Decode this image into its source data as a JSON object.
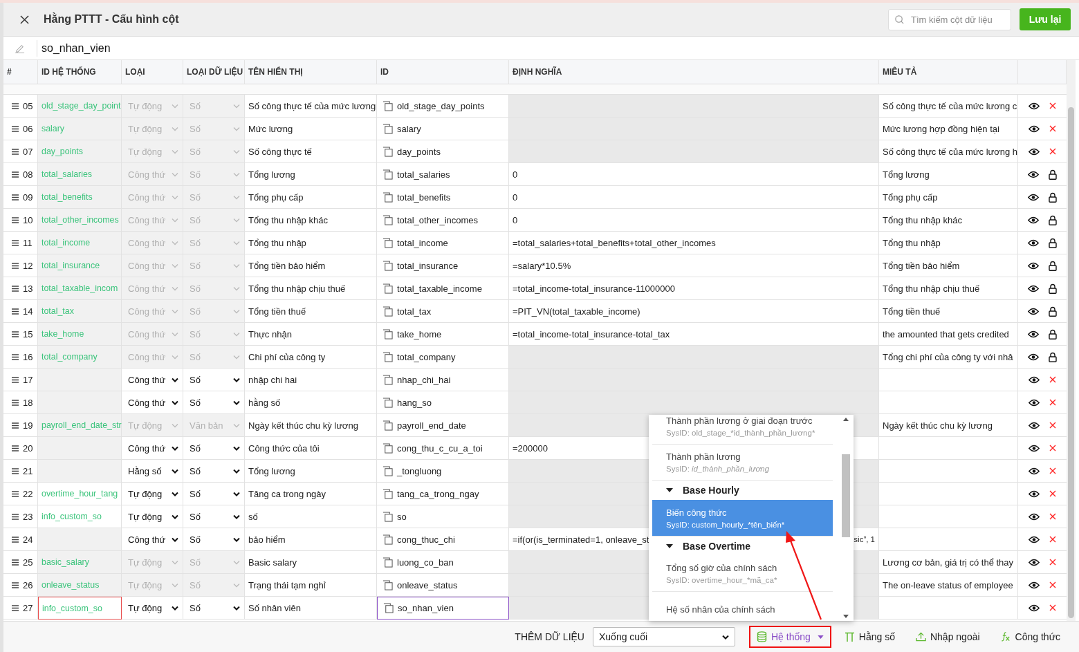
{
  "header": {
    "title": "Hằng PTTT - Cấu hình cột",
    "search": {
      "placeholder": "Tìm kiếm cột dữ liệu"
    },
    "save_button": "Lưu lại"
  },
  "name_field": {
    "value": "so_nhan_vien"
  },
  "table": {
    "columns": [
      "#",
      "ID HỆ THỐNG",
      "LOẠI",
      "LOẠI DỮ LIỆU",
      "TÊN HIỂN THỊ",
      "ID",
      "ĐỊNH NGHĨA",
      "MIÊU TẢ"
    ],
    "rows": [
      {
        "n": "05",
        "sys_id": "old_stage_day_point",
        "sys_id_disabled": true,
        "invalid": false,
        "type": "Tự động",
        "data_type": "Số",
        "locked": true,
        "display": "Số công thực tế của mức lương",
        "id": "old_stage_day_points",
        "focused": false,
        "definition": "",
        "definition_disabled": true,
        "description": "Số công thực tế của mức lương c",
        "protected": false
      },
      {
        "n": "06",
        "sys_id": "salary",
        "sys_id_disabled": true,
        "invalid": false,
        "type": "Tự động",
        "data_type": "Số",
        "locked": true,
        "display": "Mức lương",
        "id": "salary",
        "focused": false,
        "definition": "",
        "definition_disabled": true,
        "description": "Mức lương hợp đồng hiện tại",
        "protected": false
      },
      {
        "n": "07",
        "sys_id": "day_points",
        "sys_id_disabled": true,
        "invalid": false,
        "type": "Tự động",
        "data_type": "Số",
        "locked": true,
        "display": "Số công thực tế",
        "id": "day_points",
        "focused": false,
        "definition": "",
        "definition_disabled": true,
        "description": "Số công thực tế của mức lương h",
        "protected": false
      },
      {
        "n": "08",
        "sys_id": "total_salaries",
        "sys_id_disabled": true,
        "invalid": false,
        "type": "Công thứ",
        "data_type": "Số",
        "locked": true,
        "display": "Tổng lương",
        "id": "total_salaries",
        "focused": false,
        "definition": "0",
        "definition_disabled": false,
        "description": "Tổng lương",
        "protected": true
      },
      {
        "n": "09",
        "sys_id": "total_benefits",
        "sys_id_disabled": true,
        "invalid": false,
        "type": "Công thứ",
        "data_type": "Số",
        "locked": true,
        "display": "Tổng phụ cấp",
        "id": "total_benefits",
        "focused": false,
        "definition": "0",
        "definition_disabled": false,
        "description": "Tổng phụ cấp",
        "protected": true
      },
      {
        "n": "10",
        "sys_id": "total_other_incomes",
        "sys_id_disabled": true,
        "invalid": false,
        "type": "Công thứ",
        "data_type": "Số",
        "locked": true,
        "display": "Tổng thu nhập khác",
        "id": "total_other_incomes",
        "focused": false,
        "definition": "0",
        "definition_disabled": false,
        "description": "Tổng thu nhập khác",
        "protected": true
      },
      {
        "n": "11",
        "sys_id": "total_income",
        "sys_id_disabled": true,
        "invalid": false,
        "type": "Công thứ",
        "data_type": "Số",
        "locked": true,
        "display": "Tổng thu nhập",
        "id": "total_income",
        "focused": false,
        "definition": "=total_salaries+total_benefits+total_other_incomes",
        "definition_disabled": false,
        "description": "Tổng thu nhập",
        "protected": true
      },
      {
        "n": "12",
        "sys_id": "total_insurance",
        "sys_id_disabled": true,
        "invalid": false,
        "type": "Công thứ",
        "data_type": "Số",
        "locked": true,
        "display": "Tổng tiền bảo hiểm",
        "id": "total_insurance",
        "focused": false,
        "definition": "=salary*10.5%",
        "definition_disabled": false,
        "description": "Tổng tiền bảo hiểm",
        "protected": true
      },
      {
        "n": "13",
        "sys_id": "total_taxable_incom",
        "sys_id_disabled": true,
        "invalid": false,
        "type": "Công thứ",
        "data_type": "Số",
        "locked": true,
        "display": "Tổng thu nhập chịu thuế",
        "id": "total_taxable_income",
        "focused": false,
        "definition": "=total_income-total_insurance-11000000",
        "definition_disabled": false,
        "description": "Tổng thu nhập chịu thuế",
        "protected": true
      },
      {
        "n": "14",
        "sys_id": "total_tax",
        "sys_id_disabled": true,
        "invalid": false,
        "type": "Công thứ",
        "data_type": "Số",
        "locked": true,
        "display": "Tổng tiền thuế",
        "id": "total_tax",
        "focused": false,
        "definition": "=PIT_VN(total_taxable_income)",
        "definition_disabled": false,
        "description": "Tổng tiền thuế",
        "protected": true
      },
      {
        "n": "15",
        "sys_id": "take_home",
        "sys_id_disabled": true,
        "invalid": false,
        "type": "Công thứ",
        "data_type": "Số",
        "locked": true,
        "display": "Thực nhận",
        "id": "take_home",
        "focused": false,
        "definition": "=total_income-total_insurance-total_tax",
        "definition_disabled": false,
        "description": "the amounted that gets credited",
        "protected": true
      },
      {
        "n": "16",
        "sys_id": "total_company",
        "sys_id_disabled": true,
        "invalid": false,
        "type": "Công thứ",
        "data_type": "Số",
        "locked": true,
        "display": "Chi phí của công ty",
        "id": "total_company",
        "focused": false,
        "definition": "",
        "definition_disabled": true,
        "description": "Tổng chi phí của công ty với nhâ",
        "protected": true
      },
      {
        "n": "17",
        "sys_id": "",
        "sys_id_disabled": true,
        "invalid": false,
        "type": "Công thứ",
        "data_type": "Số",
        "locked": false,
        "display": "nhập chi hai",
        "id": "nhap_chi_hai",
        "focused": false,
        "definition": "",
        "definition_disabled": true,
        "description": "",
        "protected": false
      },
      {
        "n": "18",
        "sys_id": "",
        "sys_id_disabled": true,
        "invalid": false,
        "type": "Công thứ",
        "data_type": "Số",
        "locked": false,
        "display": "hằng số",
        "id": "hang_so",
        "focused": false,
        "definition": "",
        "definition_disabled": true,
        "description": "",
        "protected": false
      },
      {
        "n": "19",
        "sys_id": "payroll_end_date_str",
        "sys_id_disabled": true,
        "invalid": false,
        "type": "Tự động",
        "data_type": "Văn bản",
        "locked": true,
        "display": "Ngày kết thúc chu kỳ lương",
        "id": "payroll_end_date",
        "focused": false,
        "definition": "",
        "definition_disabled": true,
        "description": "Ngày kết thúc chu kỳ lương",
        "protected": false
      },
      {
        "n": "20",
        "sys_id": "",
        "sys_id_disabled": true,
        "invalid": false,
        "type": "Công thứ",
        "data_type": "Số",
        "locked": false,
        "display": "Công thức của tôi",
        "id": "cong_thu_c_cu_a_toi",
        "focused": false,
        "definition": "=200000",
        "definition_disabled": false,
        "description": "",
        "protected": false
      },
      {
        "n": "21",
        "sys_id": "",
        "sys_id_disabled": true,
        "invalid": false,
        "type": "Hằng số",
        "data_type": "Số",
        "locked": false,
        "display": "Tổng lương",
        "id": "_tongluong",
        "focused": false,
        "definition": "",
        "definition_disabled": true,
        "description": "",
        "protected": false
      },
      {
        "n": "22",
        "sys_id": "overtime_hour_tang",
        "sys_id_disabled": false,
        "invalid": false,
        "type": "Tự động",
        "data_type": "Số",
        "locked": false,
        "display": "Tăng ca trong ngày",
        "id": "tang_ca_trong_ngay",
        "focused": false,
        "definition": "",
        "definition_disabled": true,
        "description": "",
        "protected": false
      },
      {
        "n": "23",
        "sys_id": "info_custom_so",
        "sys_id_disabled": false,
        "invalid": false,
        "type": "Tự động",
        "data_type": "Số",
        "locked": false,
        "display": "số",
        "id": "so",
        "focused": false,
        "definition": "",
        "definition_disabled": true,
        "description": "",
        "protected": false
      },
      {
        "n": "24",
        "sys_id": "",
        "sys_id_disabled": true,
        "invalid": false,
        "type": "Công thứ",
        "data_type": "Số",
        "locked": false,
        "display": "bảo hiểm",
        "id": "cong_thuc_chi",
        "focused": false,
        "definition": "=if(or(is_terminated=1, onleave_st",
        "definition_tail": "sic”, 1",
        "definition_disabled": false,
        "description": "",
        "protected": false
      },
      {
        "n": "25",
        "sys_id": "basic_salary",
        "sys_id_disabled": true,
        "invalid": false,
        "type": "Tự động",
        "data_type": "Số",
        "locked": true,
        "display": "Basic salary",
        "id": "luong_co_ban",
        "focused": false,
        "definition": "",
        "definition_disabled": true,
        "description": "Lương cơ bản, giá trị có thể thay",
        "protected": false
      },
      {
        "n": "26",
        "sys_id": "onleave_status",
        "sys_id_disabled": true,
        "invalid": false,
        "type": "Tự động",
        "data_type": "Số",
        "locked": true,
        "display": "Trạng thái tạm nghỉ",
        "id": "onleave_status",
        "focused": false,
        "definition": "",
        "definition_disabled": true,
        "description": "The on-leave status of employee",
        "protected": false
      },
      {
        "n": "27",
        "sys_id": "info_custom_so",
        "sys_id_disabled": false,
        "invalid": true,
        "type": "Tự động",
        "data_type": "Số",
        "locked": false,
        "display": "Số nhân viên",
        "id": "so_nhan_vien",
        "focused": true,
        "definition": "",
        "definition_disabled": true,
        "description": "",
        "protected": false
      }
    ]
  },
  "dropdown": {
    "items": [
      {
        "kind": "option",
        "label": "Thành phần lương ở giai đoạn trước",
        "sysid": "SysID: old_stage_*id_thành_phần_lương*",
        "selected": false
      },
      {
        "kind": "option",
        "label": "Thành phần lương",
        "sysid": "SysID: *id_thành_phần_lương*",
        "selected": false
      },
      {
        "kind": "group",
        "label": "Base Hourly",
        "expanded": true
      },
      {
        "kind": "option",
        "label": "Biến công thức",
        "sysid": "SysID: custom_hourly_*tên_biến*",
        "selected": true
      },
      {
        "kind": "group",
        "label": "Base Overtime",
        "expanded": true
      },
      {
        "kind": "option",
        "label": "Tổng số giờ của chính sách",
        "sysid": "SysID: overtime_hour_*mã_ca*",
        "selected": false
      },
      {
        "kind": "option",
        "label": "Hệ số nhân của chính sách",
        "selected": false
      }
    ]
  },
  "footer": {
    "label": "THÊM DỮ LIỆU",
    "position_select": "Xuống cuối",
    "buttons": [
      {
        "kind": "system",
        "label": "Hệ thống",
        "highlighted": true
      },
      {
        "kind": "constant",
        "label": "Hằng số",
        "highlighted": false
      },
      {
        "kind": "import",
        "label": "Nhập ngoài",
        "highlighted": false
      },
      {
        "kind": "formula",
        "label": "Công thức",
        "highlighted": false
      }
    ]
  }
}
